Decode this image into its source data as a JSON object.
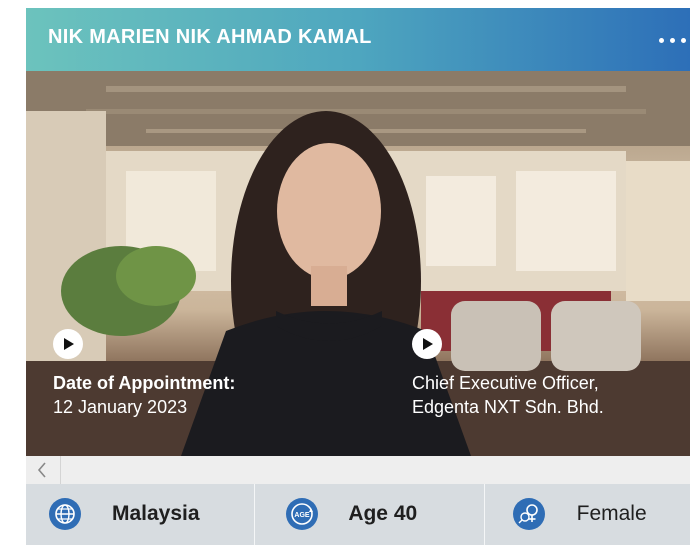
{
  "profile": {
    "name": "NIK MARIEN NIK AHMAD KAMAL",
    "more_icon": "more-dots-icon",
    "appointment_label": "Date of Appointment:",
    "appointment_date": "12 January 2023",
    "position_line1": "Chief Executive Officer,",
    "position_line2": "Edgenta NXT Sdn. Bhd."
  },
  "scrollbar": {
    "left_icon": "chevron-left-icon"
  },
  "facts": [
    {
      "icon": "globe-icon",
      "label": "Malaysia"
    },
    {
      "icon": "age-icon",
      "icon_text": "AGE",
      "label": "Age 40"
    },
    {
      "icon": "gender-icon",
      "label": "Female"
    }
  ],
  "colors": {
    "header_start": "#6cc3bd",
    "header_end": "#2d6fb8",
    "icon_blue": "#2f6db5",
    "footer_bg": "#d7dce0"
  }
}
